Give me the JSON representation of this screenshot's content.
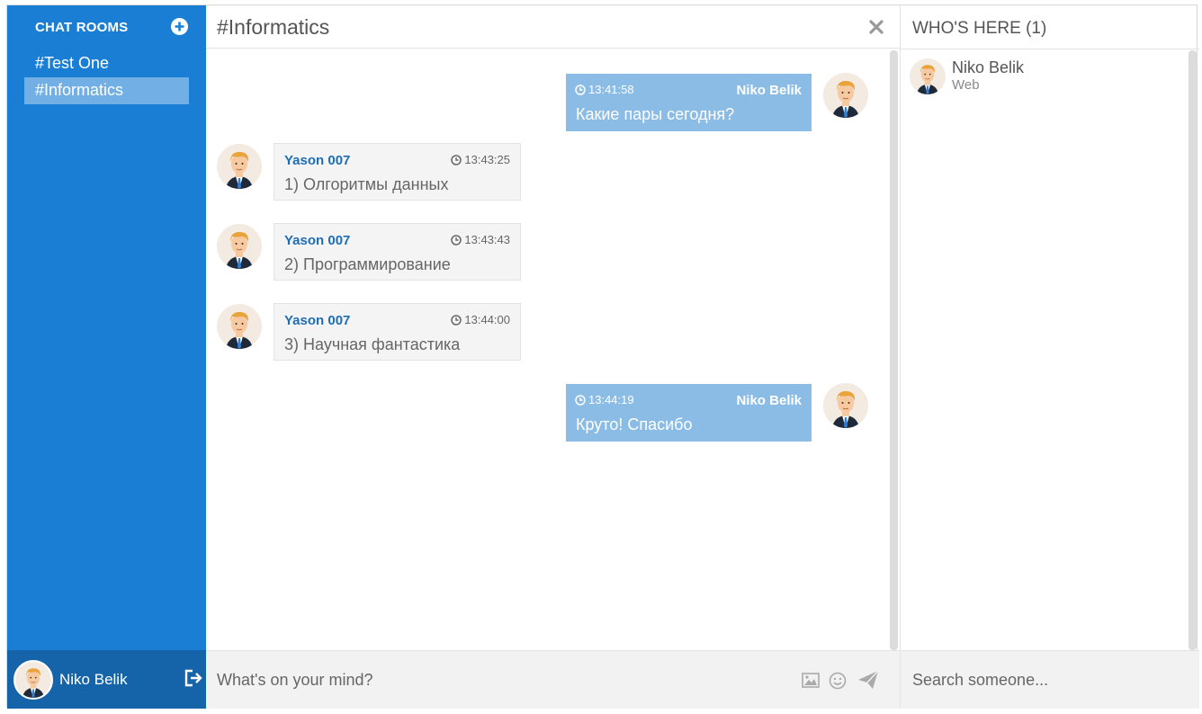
{
  "sidebar": {
    "title": "CHAT ROOMS",
    "rooms": [
      {
        "label": "#Test One",
        "active": false
      },
      {
        "label": "#Informatics",
        "active": true
      }
    ],
    "current_user": "Niko Belik"
  },
  "chat": {
    "room_title": "#Informatics",
    "messages": [
      {
        "author": "Niko Belik",
        "time": "13:41:58",
        "text": "Какие пары сегодня?",
        "mine": true
      },
      {
        "author": "Yason 007",
        "time": "13:43:25",
        "text": "1) Олгоритмы данных",
        "mine": false
      },
      {
        "author": "Yason 007",
        "time": "13:43:43",
        "text": "2) Программирование",
        "mine": false
      },
      {
        "author": "Yason 007",
        "time": "13:44:00",
        "text": "3) Научная фантастика",
        "mine": false
      },
      {
        "author": "Niko Belik",
        "time": "13:44:19",
        "text": "Круто! Спасибо",
        "mine": true
      }
    ],
    "composer_placeholder": "What's on your mind?"
  },
  "presence": {
    "title": "WHO'S HERE (1)",
    "users": [
      {
        "name": "Niko Belik",
        "client": "Web"
      }
    ],
    "search_placeholder": "Search someone..."
  },
  "colors": {
    "sidebar_bg": "#1a7fd4",
    "sidebar_footer_bg": "#1563a8",
    "my_bubble": "#8bbce6",
    "their_bubble": "#f4f4f4",
    "author_link": "#1f6db3"
  },
  "icons": [
    "add-room-icon",
    "logout-icon",
    "close-icon",
    "clock-icon",
    "image-icon",
    "emoji-icon",
    "send-icon"
  ]
}
